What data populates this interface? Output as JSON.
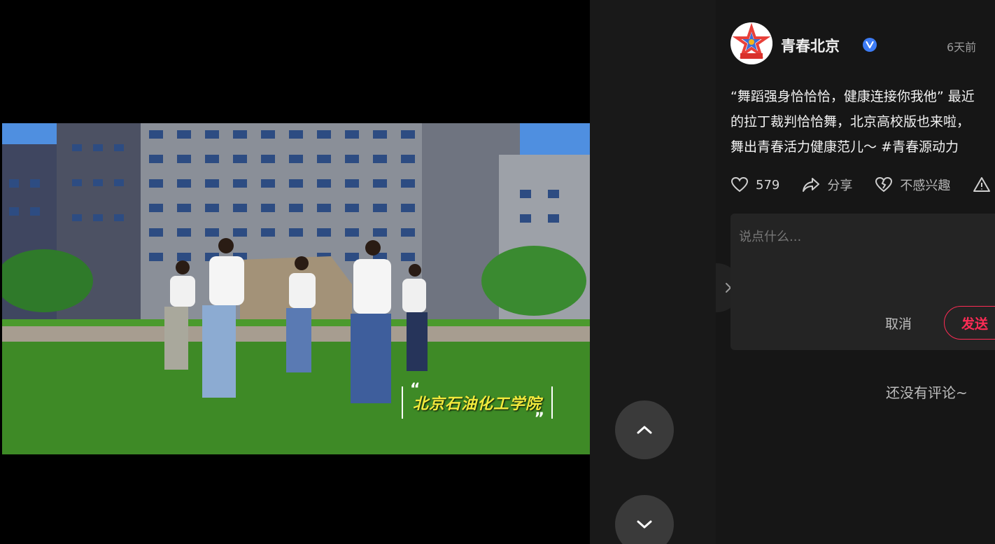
{
  "video": {
    "caption": "北京石油化工学院",
    "quote_open": "“",
    "quote_close": "”"
  },
  "navigation": {
    "prev_icon": "chevron-up-icon",
    "next_icon": "chevron-down-icon",
    "collapse_icon": "chevron-right-icon"
  },
  "author": {
    "name": "青春北京",
    "avatar_text": "青春北京",
    "verified_icon": "verified-badge-icon",
    "time": "6天前"
  },
  "post": {
    "lines": [
      "“舞蹈强身恰恰恰，健康连接你我他” 最近",
      "的拉丁裁判恰恰舞，北京高校版也来啦，",
      "舞出青春活力健康范儿～ "
    ],
    "hashtag": "#青春源动力"
  },
  "actions": {
    "likes": "579",
    "share_label": "分享",
    "dislike_label": "不感兴趣"
  },
  "comment": {
    "placeholder": "说点什么...",
    "cancel_label": "取消",
    "send_label": "发送",
    "empty_text": "还没有评论~"
  },
  "colors": {
    "accent": "#fe2c55",
    "verified": "#3d7cf5",
    "caption": "#f2ea3c"
  }
}
